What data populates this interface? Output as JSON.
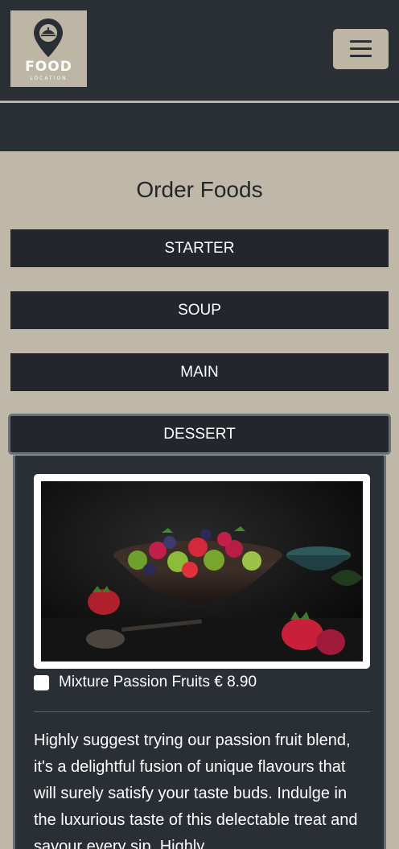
{
  "header": {
    "logo_title": "FOOD",
    "logo_subtitle": "LOCATION",
    "menu_icon": "hamburger-icon"
  },
  "main": {
    "title": "Order Foods",
    "categories": [
      {
        "label": "STARTER"
      },
      {
        "label": "SOUP"
      },
      {
        "label": "MAIN"
      },
      {
        "label": "DESSERT"
      }
    ],
    "active_category": "DESSERT"
  },
  "dessert": {
    "item_label": "Mixture Passion Fruits € 8.90",
    "checked": false,
    "description": "Highly suggest trying our passion fruit blend, it's a delightful fusion of unique flavours that will surely satisfy your taste buds. Indulge in the luxurious taste of this delectable treat and savour every sip. Highly"
  },
  "colors": {
    "dark": "#2a2f35",
    "beige": "#bfb8a8",
    "button": "#23272d"
  }
}
